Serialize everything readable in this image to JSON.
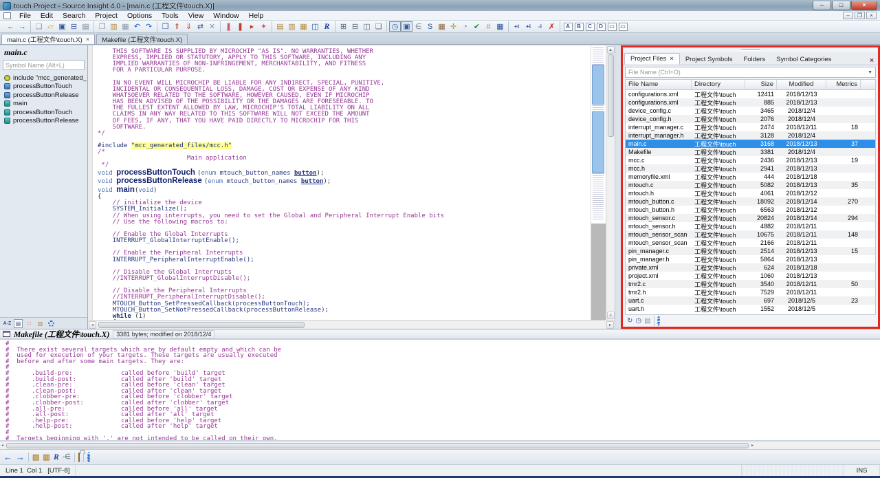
{
  "colors": {
    "annotation": "#e8251d",
    "selection": "#2e8ee8",
    "comment": "#963696",
    "accent_blue": "#1565c8"
  },
  "window": {
    "title": "touch Project - Source Insight 4.0 - [main.c (工程文件\\touch.X)]",
    "controls": {
      "minimize": "–",
      "maximize": "□",
      "close": "×"
    },
    "mdi_controls": {
      "minimize": "–",
      "restore": "❐",
      "close": "×"
    }
  },
  "menu": {
    "items": [
      "File",
      "Edit",
      "Search",
      "Project",
      "Options",
      "Tools",
      "View",
      "Window",
      "Help"
    ]
  },
  "toolbar": {
    "groups": [
      [
        {
          "n": "nav-back",
          "g": "←",
          "c": "#1565c8"
        },
        {
          "n": "nav-forward",
          "g": "→",
          "c": "#1565c8"
        }
      ],
      [
        {
          "n": "new-file",
          "g": "❏",
          "c": "#8a97a8"
        },
        {
          "n": "open-project",
          "g": "▱",
          "c": "#d79b33"
        },
        {
          "n": "save",
          "g": "▣",
          "c": "#33569c"
        },
        {
          "n": "save-all",
          "g": "⊟",
          "c": "#33569c"
        },
        {
          "n": "print",
          "g": "▤",
          "c": "#7d8795"
        }
      ],
      [
        {
          "n": "copy",
          "g": "❐",
          "c": "#8a97a8"
        },
        {
          "n": "paste",
          "g": "▥",
          "c": "#b5893c"
        },
        {
          "n": "clipboard",
          "g": "▦",
          "c": "#8a97a8"
        },
        {
          "n": "undo",
          "g": "↶",
          "c": "#1565c8"
        },
        {
          "n": "redo",
          "g": "↷",
          "c": "#1565c8"
        }
      ],
      [
        {
          "n": "open-file-list",
          "g": "❒",
          "c": "#33569c"
        },
        {
          "n": "check-out",
          "g": "⇑",
          "c": "#c23b2e"
        },
        {
          "n": "check-in",
          "g": "⇓",
          "c": "#c23b2e"
        },
        {
          "n": "sync-files",
          "g": "⇄",
          "c": "#33569c"
        },
        {
          "n": "compare-files",
          "g": "✕",
          "c": "#8a97a8"
        }
      ],
      [
        {
          "n": "flag",
          "g": "❚",
          "c": "#d05a6e"
        },
        {
          "n": "breakpoint",
          "g": "❚",
          "c": "#c23b2e"
        },
        {
          "n": "bookmark-jump",
          "g": "▸",
          "c": "#c23b2e"
        },
        {
          "n": "favorites",
          "g": "✦",
          "c": "#d05a6e"
        }
      ],
      [
        {
          "n": "browse-project",
          "g": "▤",
          "c": "#b5893c"
        },
        {
          "n": "symbol-browser",
          "g": "▥",
          "c": "#b5893c"
        },
        {
          "n": "open-book",
          "g": "▦",
          "c": "#b5893c"
        },
        {
          "n": "class-view",
          "g": "◫",
          "c": "#33569c"
        },
        {
          "n": "reference",
          "g": "R",
          "c": "#2b3f9e",
          "ital": true
        }
      ],
      [
        {
          "n": "tile-grid",
          "g": "⊞",
          "c": "#5b6b7d"
        },
        {
          "n": "tile-horizontal",
          "g": "⊟",
          "c": "#5b6b7d"
        },
        {
          "n": "tile-vertical",
          "g": "◫",
          "c": "#5b6b7d"
        },
        {
          "n": "cascade-windows",
          "g": "❏",
          "c": "#5b6b7d"
        }
      ],
      [
        {
          "n": "clock",
          "g": "◷",
          "c": "#33569c",
          "pressed": true
        },
        {
          "n": "draft-view",
          "g": "▣",
          "c": "#33569c",
          "pressed": true
        },
        {
          "n": "remove-symbol",
          "g": "∈",
          "c": "#7d8795"
        },
        {
          "n": "snippet",
          "g": "S",
          "c": "#33569c"
        },
        {
          "n": "calendar",
          "g": "▦",
          "c": "#8a6a3c"
        },
        {
          "n": "pan-hand",
          "g": "✛",
          "c": "#b5893c"
        },
        {
          "n": "clip-win",
          "g": "◔",
          "c": "#7d8795"
        },
        {
          "n": "check",
          "g": "✔",
          "c": "#2a8a3c"
        },
        {
          "n": "hash-grid",
          "g": "#",
          "c": "#b5893c"
        },
        {
          "n": "table-view",
          "g": "▦",
          "c": "#33569c"
        }
      ],
      [
        {
          "n": "indent-add",
          "g": "+t",
          "small": true,
          "c": "#33569c"
        },
        {
          "n": "line-add",
          "g": "+i",
          "small": true,
          "c": "#33569c"
        },
        {
          "n": "line-remove",
          "g": "-i",
          "small": true,
          "c": "#33569c"
        },
        {
          "n": "delete-lines",
          "g": "✗",
          "c": "#c2281d"
        }
      ],
      [
        {
          "n": "style-a",
          "g": "A",
          "boxed": true,
          "c": "#33569c"
        },
        {
          "n": "style-b",
          "g": "B",
          "boxed": true,
          "c": "#33569c"
        },
        {
          "n": "style-c",
          "g": "C",
          "boxed": true,
          "c": "#33569c"
        },
        {
          "n": "style-d",
          "g": "D",
          "boxed": true,
          "c": "#33569c"
        },
        {
          "n": "style-doc-1",
          "g": "▭",
          "boxed": true,
          "c": "#7d8795"
        },
        {
          "n": "style-doc-2",
          "g": "▭",
          "boxed": true,
          "c": "#7d8795"
        }
      ]
    ]
  },
  "tabs": [
    {
      "label": "main.c (工程文件\\touch.X)",
      "close": "×",
      "active": true
    },
    {
      "label": "Makefile (工程文件\\touch.X)",
      "close": "",
      "active": false
    }
  ],
  "sidebar": {
    "title": "main.c",
    "search_placeholder": "Symbol Name (Alt+L)",
    "symbols": [
      {
        "label": "include \"mcc_generated_",
        "icon": "include"
      },
      {
        "label": "processButtonTouch",
        "icon": "proto"
      },
      {
        "label": "processButtonRelease",
        "icon": "proto"
      },
      {
        "label": "main",
        "icon": "func"
      },
      {
        "label": "processButtonTouch",
        "icon": "func"
      },
      {
        "label": "processButtonRelease",
        "icon": "func"
      }
    ],
    "tools": [
      "a-z-sort",
      "list-view",
      "group-view",
      "book-view",
      "settings-gear"
    ]
  },
  "editor": {
    "lines": [
      [
        [
          "    THIS SOFTWARE IS SUPPLIED BY MICROCHIP \"AS IS\". NO WARRANTIES, WHETHER",
          "cmt"
        ]
      ],
      [
        [
          "    EXPRESS, IMPLIED OR STATUTORY, APPLY TO THIS SOFTWARE, INCLUDING ANY",
          "cmt"
        ]
      ],
      [
        [
          "    IMPLIED WARRANTIES OF NON-INFRINGEMENT, MERCHANTABILITY, AND FITNESS",
          "cmt"
        ]
      ],
      [
        [
          "    FOR A PARTICULAR PURPOSE.",
          "cmt"
        ]
      ],
      [],
      [
        [
          "    IN NO EVENT WILL MICROCHIP BE LIABLE FOR ANY INDIRECT, SPECIAL, PUNITIVE,",
          "cmt"
        ]
      ],
      [
        [
          "    INCIDENTAL OR CONSEQUENTIAL LOSS, DAMAGE, COST OR EXPENSE OF ANY KIND",
          "cmt"
        ]
      ],
      [
        [
          "    WHATSOEVER RELATED TO THE SOFTWARE, HOWEVER CAUSED, EVEN IF MICROCHIP",
          "cmt"
        ]
      ],
      [
        [
          "    HAS BEEN ADVISED OF THE POSSIBILITY OR THE DAMAGES ARE FORESEEABLE. TO",
          "cmt"
        ]
      ],
      [
        [
          "    THE FULLEST EXTENT ALLOWED BY LAW, MICROCHIP'S TOTAL LIABILITY ON ALL",
          "cmt"
        ]
      ],
      [
        [
          "    CLAIMS IN ANY WAY RELATED TO THIS SOFTWARE WILL NOT EXCEED THE AMOUNT",
          "cmt"
        ]
      ],
      [
        [
          "    OF FEES, IF ANY, THAT YOU HAVE PAID DIRECTLY TO MICROCHIP FOR THIS",
          "cmt"
        ]
      ],
      [
        [
          "    SOFTWARE.",
          "cmt"
        ]
      ],
      [
        [
          "*/",
          "cmt"
        ]
      ],
      [],
      [
        [
          "#include ",
          "pp"
        ],
        [
          "\"mcc_generated_files/mcc.h\"",
          "strhl"
        ]
      ],
      [
        [
          "/*",
          "cmt"
        ]
      ],
      [
        [
          "                        Main application",
          "cmt"
        ]
      ],
      [
        [
          " */",
          "cmt"
        ]
      ],
      [
        [
          "void ",
          "kw"
        ],
        [
          "processButtonTouch ",
          "fn"
        ],
        [
          "(",
          "pl"
        ],
        [
          "enum",
          "kw"
        ],
        [
          " mtouch_button_names ",
          "id"
        ],
        [
          "button",
          "un"
        ],
        [
          ");",
          "pl"
        ]
      ],
      [
        [
          "void ",
          "kw"
        ],
        [
          "processButtonRelease ",
          "fn"
        ],
        [
          "(",
          "pl"
        ],
        [
          "enum",
          "kw"
        ],
        [
          " mtouch_button_names ",
          "id"
        ],
        [
          "button",
          "un"
        ],
        [
          ");",
          "pl"
        ]
      ],
      [
        [
          "void ",
          "kw"
        ],
        [
          "main",
          "fn"
        ],
        [
          "(",
          "pl"
        ],
        [
          "void",
          "kw"
        ],
        [
          ")",
          "pl"
        ]
      ],
      [
        [
          "{",
          "pl"
        ]
      ],
      [
        [
          "    // initialize the device",
          "cmt"
        ]
      ],
      [
        [
          "    SYSTEM_Initialize();",
          "id"
        ]
      ],
      [
        [
          "    // When using interrupts, you need to set the Global and Peripheral Interrupt Enable bits",
          "cmt"
        ]
      ],
      [
        [
          "    // Use the following macros to:",
          "cmt"
        ]
      ],
      [],
      [
        [
          "    // Enable the Global Interrupts",
          "cmt"
        ]
      ],
      [
        [
          "    INTERRUPT_GlobalInterruptEnable();",
          "id"
        ]
      ],
      [],
      [
        [
          "    // Enable the Peripheral Interrupts",
          "cmt"
        ]
      ],
      [
        [
          "    INTERRUPT_PeripheralInterruptEnable();",
          "id"
        ]
      ],
      [],
      [
        [
          "    // Disable the Global Interrupts",
          "cmt"
        ]
      ],
      [
        [
          "    //INTERRUPT_GlobalInterruptDisable();",
          "cmt"
        ]
      ],
      [],
      [
        [
          "    // Disable the Peripheral Interrupts",
          "cmt"
        ]
      ],
      [
        [
          "    //INTERRUPT_PeripheralInterruptDisable();",
          "cmt"
        ]
      ],
      [
        [
          "    MTOUCH_Button_SetPressedCallback(processButtonTouch);",
          "id"
        ]
      ],
      [
        [
          "    MTOUCH_Button_SetNotPressedCallback(processButtonRelease);",
          "id"
        ]
      ],
      [
        [
          "    ",
          "pl"
        ],
        [
          "while ",
          "kwb"
        ],
        [
          "(1)",
          "pl"
        ]
      ],
      [
        [
          "    {",
          "pl"
        ]
      ]
    ]
  },
  "project_panel": {
    "tabs": [
      {
        "label": "Project Files",
        "close": "×",
        "active": true
      },
      {
        "label": "Project Symbols",
        "close": "",
        "active": false
      },
      {
        "label": "Folders",
        "close": "",
        "active": false
      },
      {
        "label": "Symbol Categories",
        "close": "",
        "active": false
      }
    ],
    "close_glyph": "×",
    "file_filter_placeholder": "File Name (Ctrl+O)",
    "columns": [
      "File Name",
      "Directory",
      "Size",
      "Modified",
      "Metrics"
    ],
    "selected_index": 6,
    "rows": [
      [
        "configurations.xml",
        "工程文件\\touch",
        "12411",
        "2018/12/13",
        ""
      ],
      [
        "configurations.xml",
        "工程文件\\touch",
        "885",
        "2018/12/13",
        ""
      ],
      [
        "device_config.c",
        "工程文件\\touch",
        "3465",
        "2018/12/4",
        ""
      ],
      [
        "device_config.h",
        "工程文件\\touch",
        "2076",
        "2018/12/4",
        ""
      ],
      [
        "interrupt_manager.c",
        "工程文件\\touch",
        "2474",
        "2018/12/11",
        "18"
      ],
      [
        "interrupt_manager.h",
        "工程文件\\touch",
        "3128",
        "2018/12/4",
        ""
      ],
      [
        "main.c",
        "工程文件\\touch",
        "3168",
        "2018/12/13",
        "37"
      ],
      [
        "Makefile",
        "工程文件\\touch",
        "3381",
        "2018/12/4",
        ""
      ],
      [
        "mcc.c",
        "工程文件\\touch",
        "2436",
        "2018/12/13",
        "19"
      ],
      [
        "mcc.h",
        "工程文件\\touch",
        "2941",
        "2018/12/13",
        ""
      ],
      [
        "memoryfile.xml",
        "工程文件\\touch",
        "444",
        "2018/12/18",
        ""
      ],
      [
        "mtouch.c",
        "工程文件\\touch",
        "5082",
        "2018/12/13",
        "35"
      ],
      [
        "mtouch.h",
        "工程文件\\touch",
        "4061",
        "2018/12/12",
        ""
      ],
      [
        "mtouch_button.c",
        "工程文件\\touch",
        "18092",
        "2018/12/14",
        "270"
      ],
      [
        "mtouch_button.h",
        "工程文件\\touch",
        "6563",
        "2018/12/12",
        ""
      ],
      [
        "mtouch_sensor.c",
        "工程文件\\touch",
        "20824",
        "2018/12/14",
        "294"
      ],
      [
        "mtouch_sensor.h",
        "工程文件\\touch",
        "4882",
        "2018/12/11",
        ""
      ],
      [
        "mtouch_sensor_scan",
        "工程文件\\touch",
        "10675",
        "2018/12/11",
        "148"
      ],
      [
        "mtouch_sensor_scan",
        "工程文件\\touch",
        "2166",
        "2018/12/11",
        ""
      ],
      [
        "pin_manager.c",
        "工程文件\\touch",
        "2514",
        "2018/12/13",
        "15"
      ],
      [
        "pin_manager.h",
        "工程文件\\touch",
        "5864",
        "2018/12/13",
        ""
      ],
      [
        "private.xml",
        "工程文件\\touch",
        "624",
        "2018/12/18",
        ""
      ],
      [
        "project.xml",
        "工程文件\\touch",
        "1060",
        "2018/12/13",
        ""
      ],
      [
        "tmr2.c",
        "工程文件\\touch",
        "3540",
        "2018/12/11",
        "50"
      ],
      [
        "tmr2.h",
        "工程文件\\touch",
        "7529",
        "2018/12/11",
        ""
      ],
      [
        "uart.c",
        "工程文件\\touch",
        "697",
        "2018/12/5",
        "23"
      ],
      [
        "uart.h",
        "工程文件\\touch",
        "1552",
        "2018/12/5",
        ""
      ]
    ],
    "tools": [
      "sync-project",
      "recent-files",
      "file-detail",
      "settings-gear"
    ]
  },
  "bottom_panel": {
    "title": "Makefile (工程文件\\touch.X)",
    "meta": "3381 bytes; modified on 2018/12/4",
    "lines": [
      "#",
      "#  There exist several targets which are by default empty and which can be",
      "#  used for execution of your targets. These targets are usually executed",
      "#  before and after some main targets. They are:",
      "#",
      "#      .build-pre:             called before 'build' target",
      "#      .build-post:            called after 'build' target",
      "#      .clean-pre:             called before 'clean' target",
      "#      .clean-post:            called after 'clean' target",
      "#      .clobber-pre:           called before 'clobber' target",
      "#      .clobber-post:          called after 'clobber' target",
      "#      .all-pre:               called before 'all' target",
      "#      .all-post:              called after 'all' target",
      "#      .help-pre:              called before 'help' target",
      "#      .help-post:             called after 'help' target",
      "#",
      "#  Targets beginning with '.' are not intended to be called on their own."
    ]
  },
  "bottom_toolbar": {
    "icons": [
      "nav-back",
      "nav-forward",
      "browse-book",
      "open-book",
      "reference",
      "symbol-out",
      "lock",
      "settings-gear"
    ]
  },
  "status": {
    "position": "Line 1  Col 1   [UTF-8]",
    "insert_mode": "INS"
  }
}
